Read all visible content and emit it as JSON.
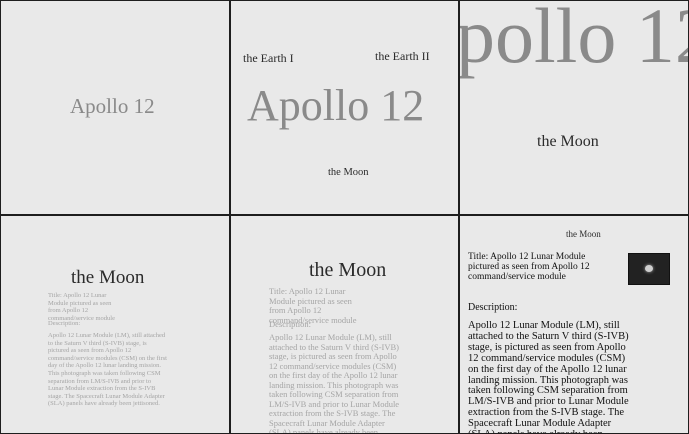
{
  "cells": {
    "c1": {
      "title": "Apollo 12"
    },
    "c2": {
      "left": "the Earth I",
      "right": "the Earth II",
      "title": "Apollo 12",
      "subtitle": "the Moon"
    },
    "c3": {
      "title": "pollo 12",
      "subtitle": "the Moon"
    },
    "c4": {
      "title": "the Moon",
      "caption": "Title: Apollo 12 Lunar Module pictured as seen from Apollo 12 command/service module",
      "desc_label": "Description:",
      "desc": "Apollo 12 Lunar Module (LM), still attached to the Saturn V third (S-IVB) stage, is pictured as seen from Apollo 12 command/service modules (CSM) on the first day of the Apollo 12 lunar landing mission. This photograph was taken following CSM separation from LM/S-IVB and prior to Lunar Module extraction from the S-IVB stage. The Spacecraft Lunar Module Adapter (SLA) panels have already been jettisoned."
    },
    "c5": {
      "title": "the Moon",
      "caption": "Title: Apollo 12 Lunar Module pictured as seen from Apollo 12 command/service module",
      "desc_label": "Description:",
      "desc": "Apollo 12 Lunar Module (LM), still attached to the Saturn V third (S-IVB) stage, is pictured as seen from Apollo 12 command/service modules (CSM) on the first day of the Apollo 12 lunar landing mission. This photograph was taken following CSM separation from LM/S-IVB and prior to Lunar Module extraction from the S-IVB stage. The Spacecraft Lunar Module Adapter (SLA) panels have already been jettisoned."
    },
    "c6": {
      "header": "the Moon",
      "title_label": "Title:",
      "title_text": "Apollo 12 Lunar Module pictured as seen from Apollo 12 command/service module",
      "desc_label": "Description:",
      "desc": "Apollo 12 Lunar Module (LM), still attached to the Saturn V third (S-IVB) stage, is pictured as seen from Apollo 12 command/service modules (CSM) on the first day of the Apollo 12 lunar landing mission. This photograph was taken following CSM separation from LM/S-IVB and prior to Lunar Module extraction from the S-IVB stage. The Spacecraft Lunar Module Adapter (SLA) panels have already been jettisoned.",
      "thumbnail_icon": "moon-photo-thumbnail"
    }
  }
}
